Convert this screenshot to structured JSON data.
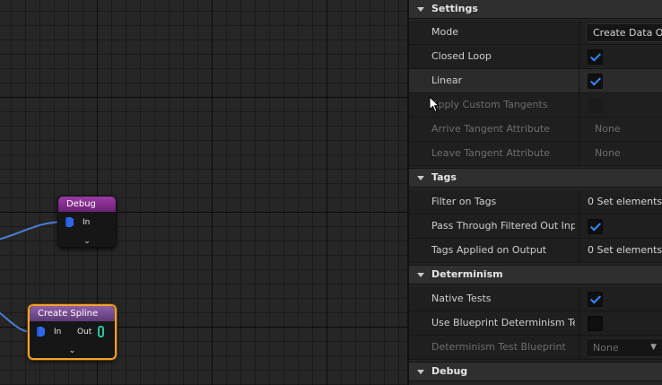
{
  "graph": {
    "nodes": {
      "debug": {
        "title": "Debug",
        "in_label": "In",
        "chevron": "⌄"
      },
      "create_spline": {
        "title": "Create Spline",
        "in_label": "In",
        "out_label": "Out",
        "chevron": "⌄"
      }
    },
    "colors": {
      "wire": "#4a7fd6",
      "selected_outline": "#f0a32a"
    }
  },
  "panel": {
    "settings": {
      "header": "Settings",
      "mode_label": "Mode",
      "mode_value": "Create Data On",
      "closed_loop_label": "Closed Loop",
      "closed_loop_checked": true,
      "linear_label": "Linear",
      "linear_checked": true,
      "apply_custom_tangents_label": "Apply Custom Tangents",
      "arrive_tangent_label": "Arrive Tangent Attribute",
      "arrive_tangent_value": "None",
      "leave_tangent_label": "Leave Tangent Attribute",
      "leave_tangent_value": "None"
    },
    "tags": {
      "header": "Tags",
      "filter_label": "Filter on Tags",
      "filter_value": "0 Set elements",
      "pass_through_label": "Pass Through Filtered Out Inp...",
      "pass_through_checked": true,
      "applied_label": "Tags Applied on Output",
      "applied_value": "0 Set elements"
    },
    "determinism": {
      "header": "Determinism",
      "native_tests_label": "Native Tests",
      "native_tests_checked": true,
      "use_bp_label": "Use Blueprint Determinism Test",
      "use_bp_checked": false,
      "test_bp_label": "Determinism Test Blueprint",
      "test_bp_value": "None"
    },
    "debug": {
      "header": "Debug"
    }
  }
}
